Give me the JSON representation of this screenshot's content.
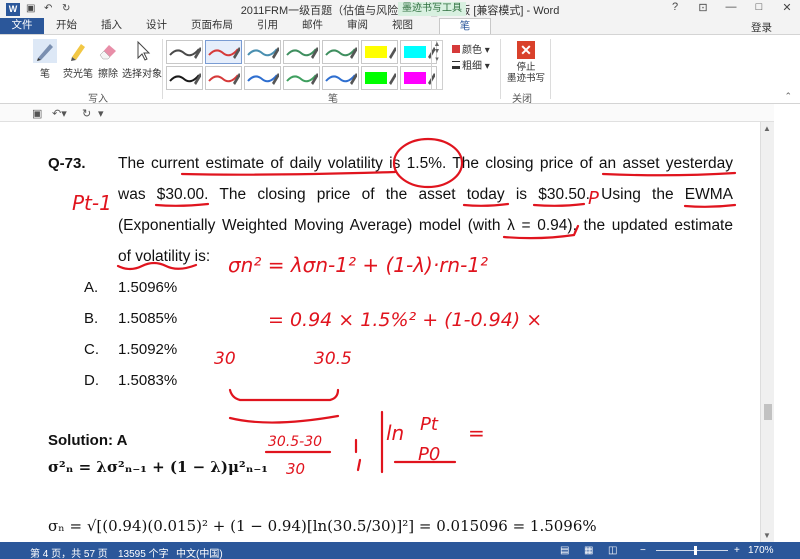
{
  "window": {
    "title": "2011FRM一级百题（估值与风险模型）_授课版 [兼容模式] - Word",
    "login": "登录",
    "controls": [
      "?",
      "⊡",
      "—",
      "□",
      "✕"
    ]
  },
  "tabs": [
    {
      "label": "文件"
    },
    {
      "label": "开始"
    },
    {
      "label": "插入"
    },
    {
      "label": "设计"
    },
    {
      "label": "页面布局"
    },
    {
      "label": "引用"
    },
    {
      "label": "邮件"
    },
    {
      "label": "审阅"
    },
    {
      "label": "视图"
    },
    {
      "label": "笔"
    }
  ],
  "contextual_tab_group": "墨迹书写工具",
  "ribbon": {
    "write_group": {
      "label": "写入",
      "buttons": [
        {
          "label": "笔",
          "icon": "pen-icon"
        },
        {
          "label": "荧光笔",
          "icon": "highlighter-icon"
        },
        {
          "label": "擦除",
          "icon": "eraser-icon"
        },
        {
          "label": "选择对象",
          "icon": "select-arrow-icon"
        }
      ]
    },
    "pens_group": {
      "label": "笔",
      "pens": [
        {
          "color": "#4a4a4a",
          "style": "stroke"
        },
        {
          "color": "#d63a3a",
          "style": "stroke"
        },
        {
          "color": "#4a8fb0",
          "style": "stroke"
        },
        {
          "color": "#3f8f5f",
          "style": "stroke"
        },
        {
          "color": "#3f8f5f",
          "style": "stroke"
        },
        {
          "color": "#ffff00",
          "style": "highlight"
        },
        {
          "color": "#00ffff",
          "style": "highlight"
        },
        {
          "color": "#1a1a1a",
          "style": "stroke"
        },
        {
          "color": "#d63a3a",
          "style": "stroke"
        },
        {
          "color": "#2f6fd0",
          "style": "stroke"
        },
        {
          "color": "#3f9f5f",
          "style": "stroke"
        },
        {
          "color": "#2f6fd0",
          "style": "stroke"
        },
        {
          "color": "#00ff00",
          "style": "highlight"
        },
        {
          "color": "#ff00ff",
          "style": "highlight"
        }
      ],
      "color_label": "颜色",
      "thickness_label": "粗细"
    },
    "close_group": {
      "label": "关闭",
      "stop_label": "停止\n墨迹书写"
    }
  },
  "document": {
    "question_number": "Q-73.",
    "question_lines": [
      "The current estimate of daily volatility is 1.5%. The closing price of an asset yesterday",
      "was $30.00. The closing price of the asset today is $30.50. Using the EWMA",
      "(Exponentially Weighted Moving Average) model (with λ = 0.94), the updated estimate",
      "of volatility is:"
    ],
    "options": [
      {
        "letter": "A.",
        "value": "1.5096%"
      },
      {
        "letter": "B.",
        "value": "1.5085%"
      },
      {
        "letter": "C.",
        "value": "1.5092%"
      },
      {
        "letter": "D.",
        "value": "1.5083%"
      }
    ],
    "solution_label": "Solution: A",
    "formula_line1": "σ²ₙ = λσ²ₙ₋₁ + (1 − λ)μ²ₙ₋₁",
    "formula_line2": "σₙ = √[(0.94)(0.015)² + (1 − 0.94)[ln(30.5/30)]²] = 0.015096 = 1.5096%"
  },
  "ink_annotations": {
    "p_left": "Pt-1",
    "p_right": "P",
    "sigma_eq": "σn² = λσn-1² + (1-λ)·rn-1²",
    "sigma_sub": "= 0.94 × 1.5%² + (1-0.94) ×",
    "num_30": "30",
    "num_305": "30.5",
    "fraction_top": "30.5-30",
    "fraction_bottom": "30",
    "ln_expr": "ln",
    "ln_top": "Pt",
    "ln_bottom": "P0",
    "ln_equals": "=",
    "ink_color": "#e0141e"
  },
  "statusbar": {
    "page": "第 4 页，共 57 页",
    "words": "13595 个字",
    "lang": "中文(中国)",
    "zoom": "170%",
    "zoom_minus": "−",
    "zoom_plus": "+"
  }
}
